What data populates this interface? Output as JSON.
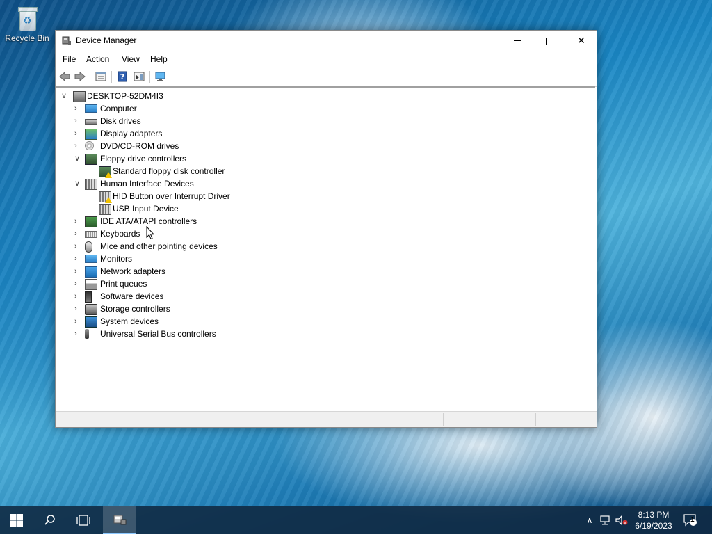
{
  "desktop": {
    "icon_label": "Recycle Bin"
  },
  "window": {
    "title": "Device Manager",
    "controls": {
      "minimize": "─",
      "maximize": "□",
      "close": "✕"
    }
  },
  "menu": [
    "File",
    "Action",
    "View",
    "Help"
  ],
  "toolbar": {
    "icons": [
      "back-arrow-icon",
      "forward-arrow-icon",
      "properties-icon",
      "help-icon",
      "action-pane-icon",
      "scan-hardware-icon"
    ]
  },
  "tree": {
    "root": "DESKTOP-52DM4I3",
    "items": [
      {
        "label": "Computer",
        "expanded": false,
        "icon": "computer-icon"
      },
      {
        "label": "Disk drives",
        "expanded": false,
        "icon": "disk-drive-icon"
      },
      {
        "label": "Display adapters",
        "expanded": false,
        "icon": "display-adapter-icon"
      },
      {
        "label": "DVD/CD-ROM drives",
        "expanded": false,
        "icon": "dvd-drive-icon"
      },
      {
        "label": "Floppy drive controllers",
        "expanded": true,
        "icon": "floppy-controller-icon",
        "children": [
          {
            "label": "Standard floppy disk controller",
            "warning": true,
            "icon": "floppy-controller-icon"
          }
        ]
      },
      {
        "label": "Human Interface Devices",
        "expanded": true,
        "icon": "hid-icon",
        "children": [
          {
            "label": "HID Button over Interrupt Driver",
            "warning": true,
            "icon": "hid-icon"
          },
          {
            "label": "USB Input Device",
            "warning": false,
            "icon": "hid-icon"
          }
        ]
      },
      {
        "label": "IDE ATA/ATAPI controllers",
        "expanded": false,
        "icon": "ide-controller-icon"
      },
      {
        "label": "Keyboards",
        "expanded": false,
        "icon": "keyboard-icon"
      },
      {
        "label": "Mice and other pointing devices",
        "expanded": false,
        "icon": "mouse-icon"
      },
      {
        "label": "Monitors",
        "expanded": false,
        "icon": "monitor-icon"
      },
      {
        "label": "Network adapters",
        "expanded": false,
        "icon": "network-adapter-icon"
      },
      {
        "label": "Print queues",
        "expanded": false,
        "icon": "printer-icon"
      },
      {
        "label": "Software devices",
        "expanded": false,
        "icon": "software-device-icon"
      },
      {
        "label": "Storage controllers",
        "expanded": false,
        "icon": "storage-controller-icon"
      },
      {
        "label": "System devices",
        "expanded": false,
        "icon": "system-device-icon"
      },
      {
        "label": "Universal Serial Bus controllers",
        "expanded": false,
        "icon": "usb-icon"
      }
    ]
  },
  "taskbar": {
    "time": "8:13 PM",
    "date": "6/19/2023",
    "notification_count": "1"
  }
}
